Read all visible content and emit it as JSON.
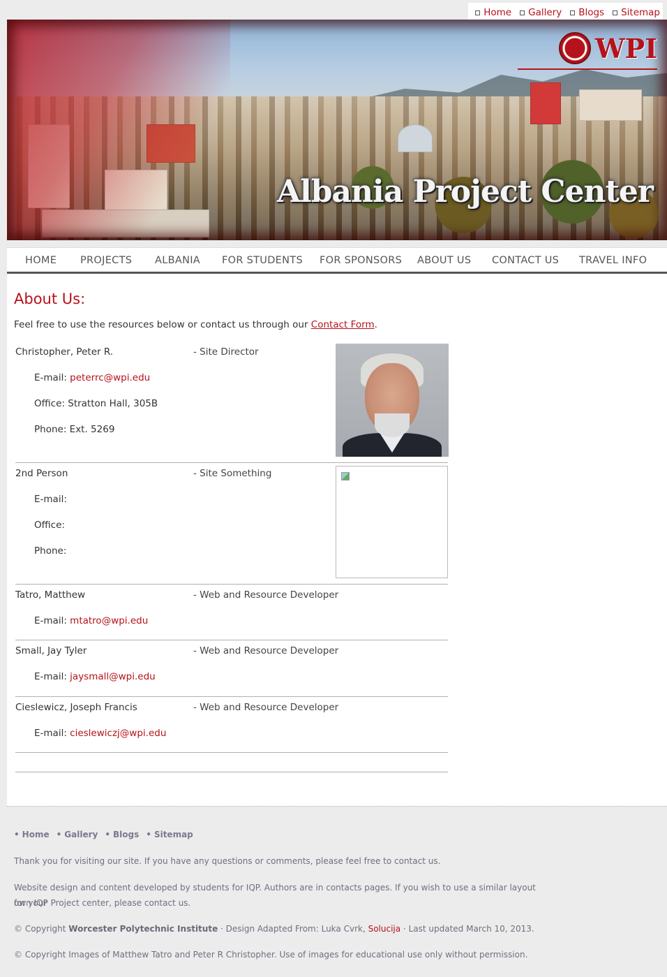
{
  "toplinks": [
    {
      "label": "Home"
    },
    {
      "label": "Gallery"
    },
    {
      "label": "Blogs"
    },
    {
      "label": "Sitemap"
    }
  ],
  "banner": {
    "title": "Albania Project Center",
    "logo_text": "WPI"
  },
  "nav": [
    {
      "label": "HOME"
    },
    {
      "label": "PROJECTS"
    },
    {
      "label": "ALBANIA"
    },
    {
      "label": "FOR STUDENTS"
    },
    {
      "label": "FOR SPONSORS"
    },
    {
      "label": "ABOUT US"
    },
    {
      "label": "CONTACT US"
    },
    {
      "label": "TRAVEL INFO"
    }
  ],
  "page": {
    "heading": "About Us:",
    "intro_before": "Feel free to use the resources below or contact us through our ",
    "intro_link": "Contact Form",
    "intro_after": "."
  },
  "people": [
    {
      "name": "Christopher, Peter R.",
      "role": "- Site Director",
      "email_label": "E-mail: ",
      "email": "peterrc@wpi.edu",
      "office": "Office: Stratton Hall, 305B",
      "phone": "Phone: Ext. 5269"
    },
    {
      "name": "2nd Person",
      "role": "- Site Something",
      "email_label": "E-mail:",
      "office": "Office:",
      "phone": "Phone:"
    },
    {
      "name": "Tatro, Matthew",
      "role": "- Web and Resource Developer",
      "email_label": "E-mail: ",
      "email": "mtatro@wpi.edu"
    },
    {
      "name": "Small, Jay Tyler",
      "role": "- Web and Resource Developer",
      "email_label": "E-mail: ",
      "email": "jaysmall@wpi.edu"
    },
    {
      "name": "Cieslewicz, Joseph Francis",
      "role": "- Web and Resource Developer",
      "email_label": "E-mail: ",
      "email": "cieslewiczj@wpi.edu"
    }
  ],
  "footer": {
    "links": [
      {
        "label": "Home"
      },
      {
        "label": "Gallery"
      },
      {
        "label": "Blogs"
      },
      {
        "label": "Sitemap"
      }
    ],
    "thanks": "Thank you for visiting our site. If you have any questions or comments, please feel free to contact us.",
    "credits_line1": "Website design and content developed by students for IQP. Authors are in contacts pages. If you wish to use a similar layout for your",
    "credits_line2": "own IQP Project center, please contact us.",
    "copyright_prefix": "© Copyright ",
    "copyright_org": "Worcester Polytechnic Institute",
    "copyright_mid": " · Design Adapted From: Luka Cvrk, ",
    "copyright_link": "Solucija",
    "copyright_suffix": " · Last updated March 10, 2013.",
    "images_copyright": "© Copyright Images of Matthew Tatro and Peter R Christopher. Use of images for educational use only without permission."
  },
  "colors": {
    "accent": "#b5121b",
    "nav_text": "#555555",
    "footer_bg": "#ececec"
  }
}
